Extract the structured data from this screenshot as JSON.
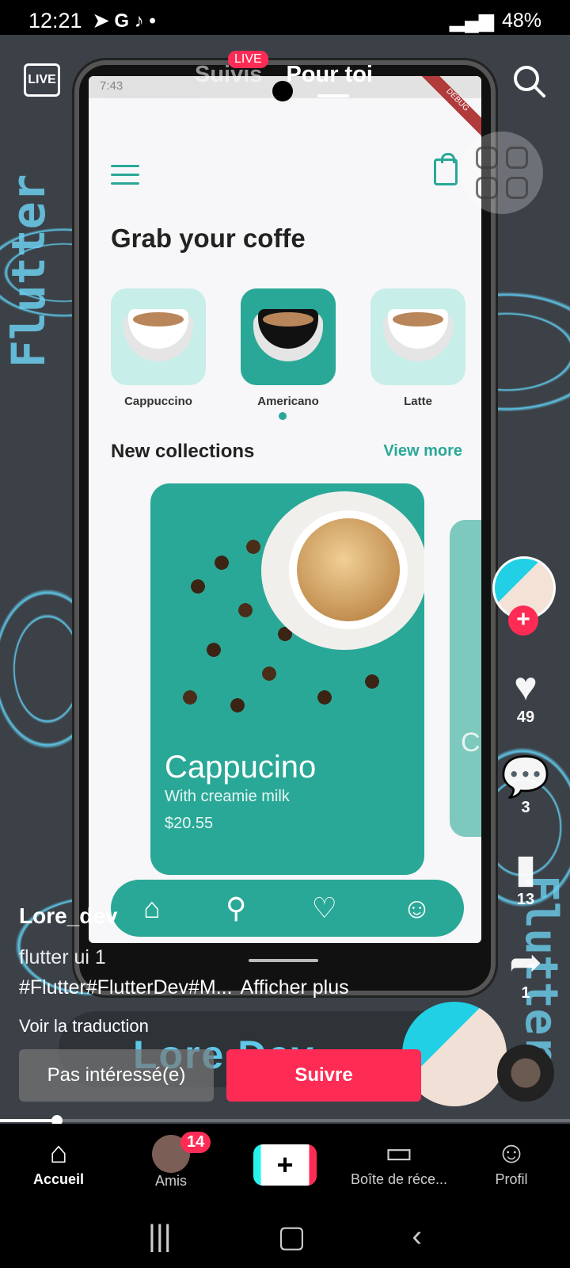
{
  "status_bar": {
    "time": "12:21",
    "app_icons": "➤ G ♪ •",
    "battery": "48%"
  },
  "phone_app": {
    "status_time": "7:43",
    "debug": "DEBUG",
    "title": "Grab your coffe",
    "categories": [
      {
        "label": "Cappuccino",
        "active": false
      },
      {
        "label": "Americano",
        "active": true
      },
      {
        "label": "Latte",
        "active": false
      }
    ],
    "section_title": "New collections",
    "view_more": "View more",
    "card": {
      "title": "Cappucino",
      "subtitle": "With creamie milk",
      "price": "$20.55"
    },
    "next_card_initial": "C",
    "accent": "#2aa897"
  },
  "top": {
    "live": "LIVE",
    "tab_following": "Suivis",
    "live_badge": "LIVE",
    "tab_for_you": "Pour toi"
  },
  "side": {
    "likes": "49",
    "comments": "3",
    "saves": "13",
    "shares": "1"
  },
  "post": {
    "author": "Lore_dev",
    "description": "flutter ui 1",
    "tags": "#Flutter#FlutterDev#M...",
    "show_more": "Afficher plus",
    "translate": "Voir la traduction",
    "brand_name": "Lore Dev",
    "watermark_text": "Flutter",
    "progress": 0.1
  },
  "actions": {
    "not_interested": "Pas intéressé(e)",
    "follow": "Suivre"
  },
  "bottom_nav": {
    "home": "Accueil",
    "friends": "Amis",
    "friends_badge": "14",
    "create": "+",
    "inbox": "Boîte de réce...",
    "profile": "Profil"
  },
  "colors": {
    "tiktok_red": "#fe2c55",
    "tiktok_cyan": "#25f4ee"
  }
}
